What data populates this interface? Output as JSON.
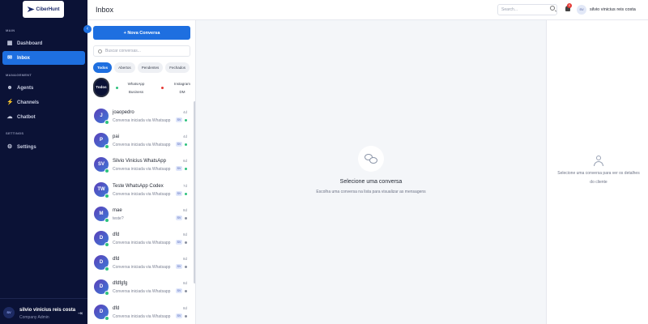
{
  "logo": {
    "text": "CiberHunt"
  },
  "sidebar": {
    "sections": [
      {
        "label": "MAIN"
      },
      {
        "label": "MANAGEMENT"
      },
      {
        "label": "SETTINGS"
      }
    ],
    "items": [
      {
        "label": "Dashboard",
        "icon": "dashboard-icon",
        "active": false
      },
      {
        "label": "Inbox",
        "icon": "inbox-icon",
        "active": true
      },
      {
        "label": "Agents",
        "icon": "agents-icon",
        "active": false
      },
      {
        "label": "Channels",
        "icon": "channels-icon",
        "active": false
      },
      {
        "label": "Chatbot",
        "icon": "chatbot-icon",
        "active": false
      },
      {
        "label": "Settings",
        "icon": "gear-icon",
        "active": false
      }
    ],
    "user": {
      "initials": "SV",
      "name": "silvio vinicius reis costa",
      "role": "Company Admin"
    }
  },
  "header": {
    "title": "Inbox",
    "search_placeholder": "Search...",
    "notification_count": "0",
    "user_initials": "SV",
    "user_name": "silvio vinicius reis costa"
  },
  "list": {
    "new_button": "+ Nova Conversa",
    "search_placeholder": "Buscar conversas...",
    "filters": [
      "Todos",
      "Abertos",
      "Pendentes",
      "Fechados"
    ],
    "active_filter": "Todos",
    "channels": {
      "all": "Todos",
      "whatsapp_line1": "WhatsApp",
      "whatsapp_line2": "Business",
      "instagram_line1": "Instagram",
      "instagram_line2": "DM"
    },
    "conversations": [
      {
        "initials": "J",
        "name": "joaopedro",
        "time": "4d",
        "preview": "Conversa iniciada via Whatsapp",
        "badge": "SV",
        "status": "#2ec27e"
      },
      {
        "initials": "P",
        "name": "pai",
        "time": "4d",
        "preview": "Conversa iniciada via Whatsapp",
        "badge": "SV",
        "status": "#2ec27e"
      },
      {
        "initials": "SV",
        "name": "Silvio Vinicius WhatsApp",
        "time": "6d",
        "preview": "Conversa iniciada via Whatsapp",
        "badge": "SV",
        "status": "#2ec27e"
      },
      {
        "initials": "TW",
        "name": "Teste WhatsApp Codex",
        "time": "7d",
        "preview": "Conversa iniciada via Whatsapp",
        "badge": "SV",
        "status": "#2ec27e"
      },
      {
        "initials": "M",
        "name": "mae",
        "time": "8d",
        "preview": "teste?",
        "badge": "SV",
        "status": "#8a90a0"
      },
      {
        "initials": "D",
        "name": "dfd",
        "time": "8d",
        "preview": "Conversa iniciada via Whatsapp",
        "badge": "SV",
        "status": "#8a90a0"
      },
      {
        "initials": "D",
        "name": "dfd",
        "time": "8d",
        "preview": "Conversa iniciada via Whatsapp",
        "badge": "SV",
        "status": "#8a90a0"
      },
      {
        "initials": "D",
        "name": "dfdfgfg",
        "time": "8d",
        "preview": "Conversa iniciada via Whatsapp",
        "badge": "SV",
        "status": "#8a90a0"
      },
      {
        "initials": "D",
        "name": "dfd",
        "time": "8d",
        "preview": "Conversa iniciada via Whatsapp",
        "badge": "SV",
        "status": "#8a90a0"
      }
    ]
  },
  "empty_state": {
    "title": "Selecione uma conversa",
    "subtitle": "Escolha uma conversa na lista para visualizar as mensagens"
  },
  "detail": {
    "text": "Selecione uma conversa para ver os detalhes do cliente"
  },
  "colors": {
    "sidebar_bg": "#0b1236",
    "accent": "#1e6fe0",
    "whatsapp_green": "#2ec27e",
    "instagram_red": "#e53935"
  }
}
